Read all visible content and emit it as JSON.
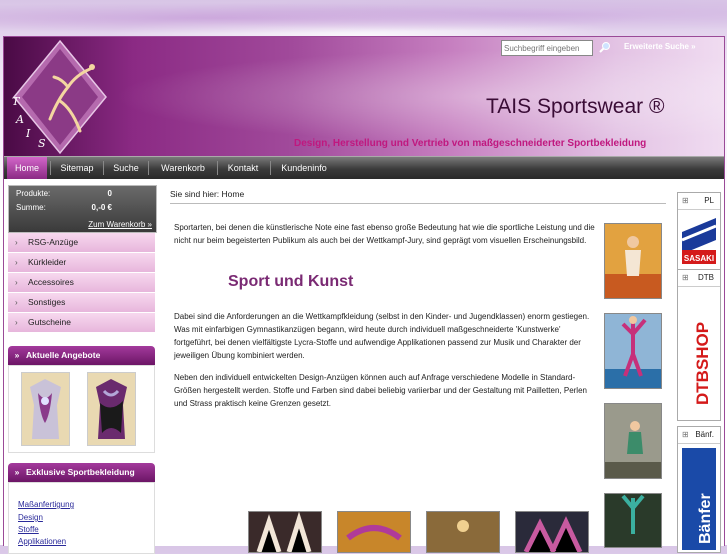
{
  "search": {
    "placeholder": "Suchbegriff eingeben",
    "advanced_label": "Erweiterte Suche »"
  },
  "header": {
    "brand": "TAIS Sportswear ®",
    "tagline": "Design, Herstellung und Vertrieb von maßgeschneiderter Sportbekleidung",
    "logo_letters": [
      "T",
      "A",
      "I",
      "S"
    ]
  },
  "nav": [
    {
      "label": "Home",
      "active": true
    },
    {
      "label": "Sitemap"
    },
    {
      "label": "Suche"
    },
    {
      "label": "Warenkorb"
    },
    {
      "label": "Kontakt"
    },
    {
      "label": "Kundeninfo"
    }
  ],
  "cart": {
    "products_label": "Produkte:",
    "products_value": "0",
    "sum_label": "Summe:",
    "sum_value": "0,-0 €",
    "link": "Zum Warenkorb »"
  },
  "categories": [
    "RSG-Anzüge",
    "Kürkleider",
    "Accessoires",
    "Sonstiges",
    "Gutscheine"
  ],
  "offers": {
    "title": "Aktuelle Angebote"
  },
  "exclusive": {
    "title": "Exklusive Sportbekleidung",
    "links": [
      "Maßanfertigung",
      "Design",
      "Stoffe",
      "Applikationen"
    ]
  },
  "breadcrumb": "Sie sind hier: Home",
  "main": {
    "intro": "Sportarten, bei denen die künstlerische Note eine fast ebenso große Bedeutung hat wie die sportliche Leistung und die nicht nur beim begeisterten Publikum als auch bei der Wettkampf-Jury, sind geprägt vom visuellen Erscheinungsbild.",
    "heading": "Sport und Kunst",
    "para2": "Dabei sind die Anforderungen an die Wettkampfkleidung (selbst in den Kinder- und Jugendklassen) enorm gestiegen. Was mit einfarbigen Gymnastikanzügen begann, wird heute durch individuell maßgeschneiderte 'Kunstwerke' fortgeführt, bei denen vielfältigste Lycra-Stoffe und aufwendige Applikationen passend zur Musik und Charakter der jeweiligen Übung kombiniert werden.",
    "para3": "Neben den individuell entwickelten Design-Anzügen können auch auf Anfrage verschiedene Modelle in Standard-Größen hergestellt werden. Stoffe und Farben sind dabei beliebig variierbar und der Gestaltung mit Pailletten, Perlen und Strass praktisch keine Grenzen gesetzt."
  },
  "right": [
    {
      "title": "PL",
      "banner": "SASAKI"
    },
    {
      "title": "DTB",
      "banner": "DTBSHOP"
    },
    {
      "title": "Bänf.",
      "banner": "Bänfer"
    }
  ],
  "colors": {
    "accent": "#8b2a84",
    "heading": "#7a2a73",
    "tagline": "#c0187f"
  }
}
